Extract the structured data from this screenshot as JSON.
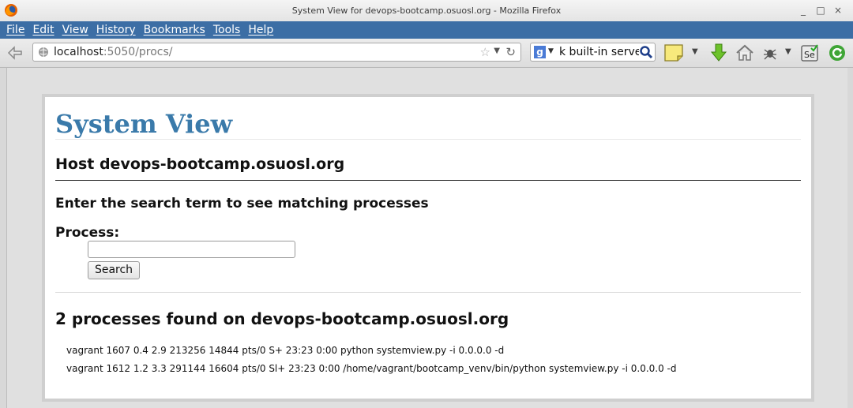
{
  "window": {
    "title": "System View for devops-bootcamp.osuosl.org - Mozilla Firefox",
    "controls": [
      "_",
      "□",
      "×"
    ]
  },
  "menu": [
    "File",
    "Edit",
    "View",
    "History",
    "Bookmarks",
    "Tools",
    "Help"
  ],
  "nav": {
    "url_host": "localhost",
    "url_path": ":5050/procs/",
    "search_value": "k built-in server",
    "search_engine_icon": "google-g-icon"
  },
  "page": {
    "title": "System View",
    "host_heading": "Host devops-bootcamp.osuosl.org",
    "prompt_heading": "Enter the search term to see matching processes",
    "process_label": "Process:",
    "process_input_value": "",
    "search_button": "Search",
    "results_heading": "2 processes found on devops-bootcamp.osuosl.org",
    "processes": [
      "vagrant 1607 0.4 2.9 213256 14844 pts/0 S+ 23:23 0:00 python systemview.py -i 0.0.0.0 -d",
      "vagrant 1612 1.2 3.3 291144 16604 pts/0 Sl+ 23:23 0:00 /home/vagrant/bootcamp_venv/bin/python systemview.py -i 0.0.0.0 -d"
    ]
  },
  "colors": {
    "menubar": "#3c6ea5",
    "title_accent": "#3a7aaa"
  }
}
